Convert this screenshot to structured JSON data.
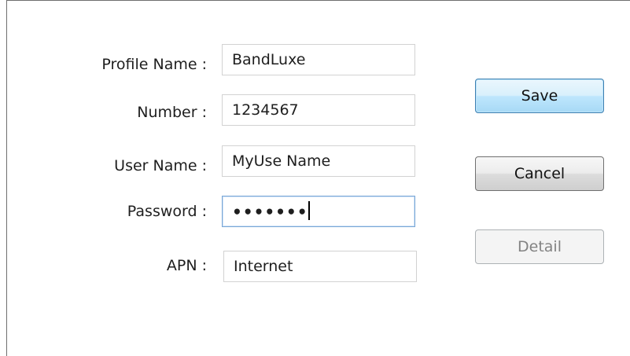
{
  "form": {
    "profile_name": {
      "label": "Profile Name :",
      "value": "BandLuxe"
    },
    "number": {
      "label": "Number :",
      "value": "1234567"
    },
    "user_name": {
      "label": "User Name :",
      "value": "MyUse Name"
    },
    "password": {
      "label": "Password :",
      "masked_value": "•••••••"
    },
    "apn": {
      "label": "APN :",
      "value": "Internet"
    }
  },
  "buttons": {
    "save": "Save",
    "cancel": "Cancel",
    "detail": "Detail"
  },
  "colors": {
    "default_button_border": "#3c7fb1",
    "focus_border": "#7aa7d6",
    "disabled_text": "#838383"
  }
}
